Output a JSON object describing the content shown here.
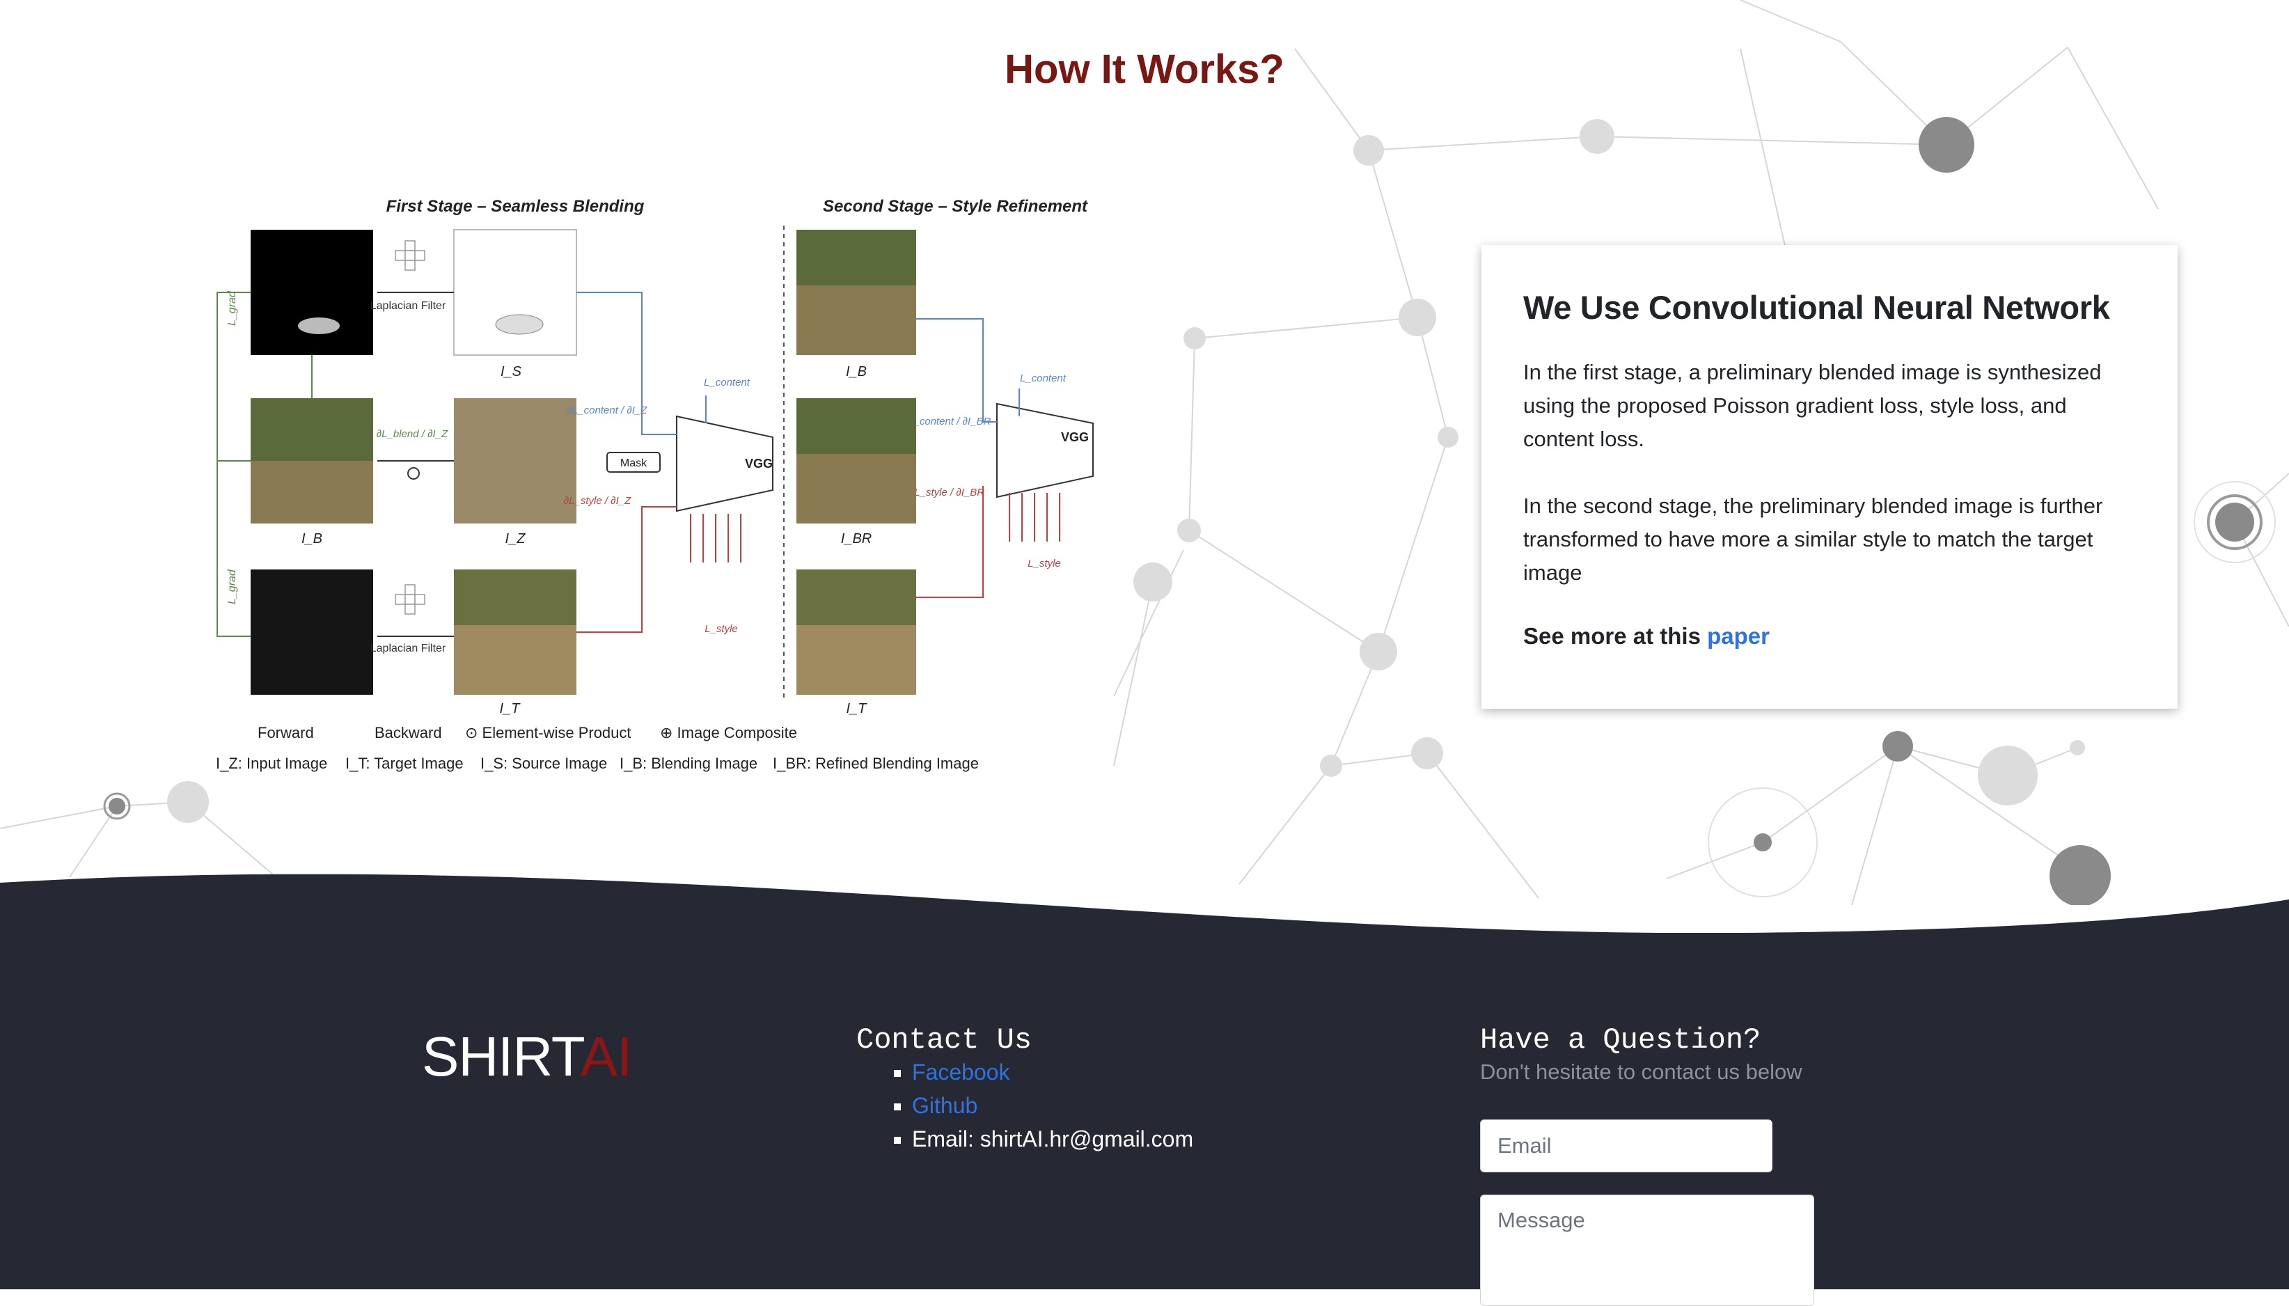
{
  "how_it_works": {
    "title": "How It Works?",
    "diagram": {
      "stage1_title": "First Stage – Seamless Blending",
      "stage2_title": "Second Stage – Style Refinement",
      "laplacian_label": "Laplacian Filter",
      "vgg_label": "VGG",
      "mask_label": "Mask",
      "labels": {
        "lgrad": "L_grad",
        "is": "I_S",
        "ib": "I_B",
        "iz": "I_Z",
        "it": "I_T",
        "ibr": "I_BR",
        "lcontent": "L_content",
        "lstyle": "L_style",
        "dlblend": "∂L_blend / ∂I_Z",
        "dlcontent_z": "∂L_content / ∂I_Z",
        "dlstyle_z": "∂L_style / ∂I_Z",
        "dlcontent_br": "∂L_content / ∂I_BR",
        "dlstyle_br": "∂L_style / ∂I_BR"
      },
      "legend_row1": [
        "Forward",
        "Backward",
        "⊙ Element-wise Product",
        "⊕ Image Composite"
      ],
      "legend_row2": [
        "I_Z: Input Image",
        "I_T: Target Image",
        "I_S: Source Image",
        "I_B: Blending Image",
        "I_BR: Refined Blending Image"
      ]
    },
    "card": {
      "title": "We Use Convolutional Neural Network",
      "para1": "In the first stage, a preliminary blended image is synthesized using the proposed Poisson gradient loss, style loss, and content loss.",
      "para2": "In the second stage, the preliminary blended image is further transformed to have more a similar style to match the target image",
      "see_more": "See more at this ",
      "link_text": "paper"
    }
  },
  "footer": {
    "brand_main": "SHIRT",
    "brand_ai": "AI",
    "contact_title": "Contact Us",
    "contact_items": {
      "facebook": "Facebook",
      "github": "Github",
      "email": "Email: shirtAI.hr@gmail.com"
    },
    "question_title": "Have a Question?",
    "question_sub": "Don't hesitate to contact us below",
    "email_placeholder": "Email",
    "message_placeholder": "Message"
  },
  "colors": {
    "title": "#7a1713",
    "footer_bg": "#262834",
    "link": "#2f73e0",
    "brand_ai": "#8b1616"
  }
}
